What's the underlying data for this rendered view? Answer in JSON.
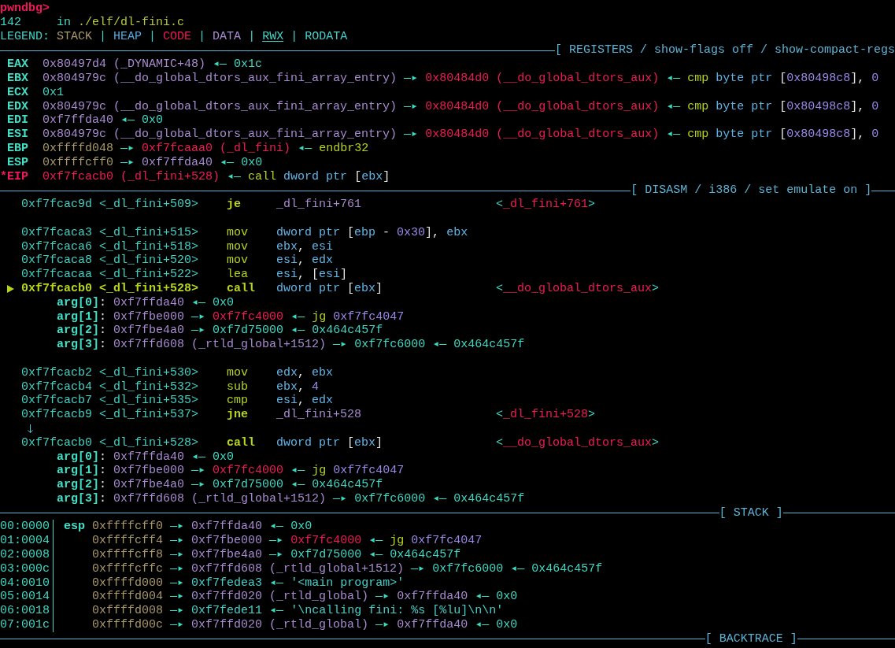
{
  "prompt": "pwndbg>",
  "source": {
    "line_number": "142",
    "location": [
      {
        "text": "in ",
        "kind": "value"
      },
      {
        "text": "./elf/dl-fini.c",
        "kind": "path"
      }
    ]
  },
  "legend": [
    {
      "text": "LEGEND: ",
      "kind": "label"
    },
    {
      "text": "STACK",
      "kind": "stack"
    },
    {
      "text": " | ",
      "kind": "label"
    },
    {
      "text": "HEAP",
      "kind": "heap"
    },
    {
      "text": " | ",
      "kind": "label"
    },
    {
      "text": "CODE",
      "kind": "code"
    },
    {
      "text": " | ",
      "kind": "label"
    },
    {
      "text": "DATA",
      "kind": "data"
    },
    {
      "text": " | ",
      "kind": "label"
    },
    {
      "text": "RWX",
      "kind": "rwx"
    },
    {
      "text": " | ",
      "kind": "label"
    },
    {
      "text": "RODATA",
      "kind": "rodata"
    }
  ],
  "registers": {
    "header": {
      "title": "[ REGISTERS / show-flags off / show-compact-regs",
      "clipped": true
    },
    "rows": [
      {
        "name": "EAX",
        "modified": false,
        "value": [
          {
            "text": "0x80497d4 (_DYNAMIC+48)",
            "kind": "data"
          },
          {
            "text": " ◂— ",
            "kind": "arrow"
          },
          {
            "text": "0x1c",
            "kind": "value"
          }
        ]
      },
      {
        "name": "EBX",
        "modified": false,
        "value": [
          {
            "text": "0x804979c (__do_global_dtors_aux_fini_array_entry)",
            "kind": "data"
          },
          {
            "text": " —▸ ",
            "kind": "arrow"
          },
          {
            "text": "0x80484d0 (__do_global_dtors_aux)",
            "kind": "code"
          },
          {
            "text": " ◂— ",
            "kind": "arrow"
          },
          {
            "text": "cmp ",
            "kind": "insn"
          },
          {
            "text": "byte ptr ",
            "kind": "keyword"
          },
          {
            "text": "[",
            "kind": "punct"
          },
          {
            "text": "0x80498c8",
            "kind": "number"
          },
          {
            "text": "], ",
            "kind": "punct"
          },
          {
            "text": "0",
            "kind": "number"
          }
        ]
      },
      {
        "name": "ECX",
        "modified": false,
        "value": [
          {
            "text": "0x1",
            "kind": "value"
          }
        ]
      },
      {
        "name": "EDX",
        "modified": false,
        "value": [
          {
            "text": "0x804979c (__do_global_dtors_aux_fini_array_entry)",
            "kind": "data"
          },
          {
            "text": " —▸ ",
            "kind": "arrow"
          },
          {
            "text": "0x80484d0 (__do_global_dtors_aux)",
            "kind": "code"
          },
          {
            "text": " ◂— ",
            "kind": "arrow"
          },
          {
            "text": "cmp ",
            "kind": "insn"
          },
          {
            "text": "byte ptr ",
            "kind": "keyword"
          },
          {
            "text": "[",
            "kind": "punct"
          },
          {
            "text": "0x80498c8",
            "kind": "number"
          },
          {
            "text": "], ",
            "kind": "punct"
          },
          {
            "text": "0",
            "kind": "number"
          }
        ]
      },
      {
        "name": "EDI",
        "modified": false,
        "value": [
          {
            "text": "0xf7ffda40",
            "kind": "data"
          },
          {
            "text": " ◂— ",
            "kind": "arrow"
          },
          {
            "text": "0x0",
            "kind": "value"
          }
        ]
      },
      {
        "name": "ESI",
        "modified": false,
        "value": [
          {
            "text": "0x804979c (__do_global_dtors_aux_fini_array_entry)",
            "kind": "data"
          },
          {
            "text": " —▸ ",
            "kind": "arrow"
          },
          {
            "text": "0x80484d0 (__do_global_dtors_aux)",
            "kind": "code"
          },
          {
            "text": " ◂— ",
            "kind": "arrow"
          },
          {
            "text": "cmp ",
            "kind": "insn"
          },
          {
            "text": "byte ptr ",
            "kind": "keyword"
          },
          {
            "text": "[",
            "kind": "punct"
          },
          {
            "text": "0x80498c8",
            "kind": "number"
          },
          {
            "text": "], ",
            "kind": "punct"
          },
          {
            "text": "0",
            "kind": "number"
          }
        ]
      },
      {
        "name": "EBP",
        "modified": false,
        "value": [
          {
            "text": "0xffffd048",
            "kind": "stack"
          },
          {
            "text": " —▸ ",
            "kind": "arrow"
          },
          {
            "text": "0xf7fcaaa0 (_dl_fini)",
            "kind": "code"
          },
          {
            "text": " ◂— ",
            "kind": "arrow"
          },
          {
            "text": "endbr32",
            "kind": "insn"
          }
        ]
      },
      {
        "name": "ESP",
        "modified": false,
        "value": [
          {
            "text": "0xffffcff0",
            "kind": "stack"
          },
          {
            "text": " —▸ ",
            "kind": "arrow"
          },
          {
            "text": "0xf7ffda40",
            "kind": "data"
          },
          {
            "text": " ◂— ",
            "kind": "arrow"
          },
          {
            "text": "0x0",
            "kind": "value"
          }
        ]
      },
      {
        "name": "*EIP",
        "modified": true,
        "value": [
          {
            "text": "0xf7fcacb0 (_dl_fini+528)",
            "kind": "code"
          },
          {
            "text": " ◂— ",
            "kind": "arrow"
          },
          {
            "text": "call ",
            "kind": "insn"
          },
          {
            "text": "dword ptr ",
            "kind": "keyword"
          },
          {
            "text": "[",
            "kind": "punct"
          },
          {
            "text": "ebx",
            "kind": "keyword"
          },
          {
            "text": "]",
            "kind": "punct"
          }
        ]
      }
    ]
  },
  "disasm": {
    "header": {
      "title": "[ DISASM / i386 / set emulate on ]",
      "clipped": false
    },
    "rows": [
      {
        "kind": "instruction",
        "current": false,
        "address": "0xf7fcac9d",
        "symbol": "<_dl_fini+509>",
        "mnemonic": "je",
        "branch": true,
        "operands": [
          {
            "text": "_dl_fini+761",
            "kind": "data"
          }
        ],
        "target": [
          {
            "text": "<",
            "kind": "value"
          },
          {
            "text": "_dl_fini+761",
            "kind": "code"
          },
          {
            "text": ">",
            "kind": "value"
          }
        ]
      },
      {
        "kind": "gap"
      },
      {
        "kind": "instruction",
        "current": false,
        "address": "0xf7fcaca3",
        "symbol": "<_dl_fini+515>",
        "mnemonic": "mov",
        "branch": false,
        "operands": [
          {
            "text": "dword ptr ",
            "kind": "keyword"
          },
          {
            "text": "[",
            "kind": "punct"
          },
          {
            "text": "ebp",
            "kind": "keyword"
          },
          {
            "text": " - ",
            "kind": "punct"
          },
          {
            "text": "0x30",
            "kind": "number"
          },
          {
            "text": "], ",
            "kind": "punct"
          },
          {
            "text": "ebx",
            "kind": "keyword"
          }
        ]
      },
      {
        "kind": "instruction",
        "current": false,
        "address": "0xf7fcaca6",
        "symbol": "<_dl_fini+518>",
        "mnemonic": "mov",
        "branch": false,
        "operands": [
          {
            "text": "ebx",
            "kind": "keyword"
          },
          {
            "text": ", ",
            "kind": "punct"
          },
          {
            "text": "esi",
            "kind": "keyword"
          }
        ]
      },
      {
        "kind": "instruction",
        "current": false,
        "address": "0xf7fcaca8",
        "symbol": "<_dl_fini+520>",
        "mnemonic": "mov",
        "branch": false,
        "operands": [
          {
            "text": "esi",
            "kind": "keyword"
          },
          {
            "text": ", ",
            "kind": "punct"
          },
          {
            "text": "edx",
            "kind": "keyword"
          }
        ]
      },
      {
        "kind": "instruction",
        "current": false,
        "address": "0xf7fcacaa",
        "symbol": "<_dl_fini+522>",
        "mnemonic": "lea",
        "branch": false,
        "operands": [
          {
            "text": "esi",
            "kind": "keyword"
          },
          {
            "text": ", [",
            "kind": "punct"
          },
          {
            "text": "esi",
            "kind": "keyword"
          },
          {
            "text": "]",
            "kind": "punct"
          }
        ]
      },
      {
        "kind": "instruction",
        "current": true,
        "address": "0xf7fcacb0",
        "symbol": "<_dl_fini+528>",
        "mnemonic": "call",
        "branch": true,
        "operands": [
          {
            "text": "dword ptr ",
            "kind": "keyword"
          },
          {
            "text": "[",
            "kind": "punct"
          },
          {
            "text": "ebx",
            "kind": "keyword"
          },
          {
            "text": "]",
            "kind": "punct"
          }
        ],
        "target": [
          {
            "text": "<",
            "kind": "value"
          },
          {
            "text": "__do_global_dtors_aux",
            "kind": "code"
          },
          {
            "text": ">",
            "kind": "value"
          }
        ]
      },
      {
        "kind": "argument",
        "segments": [
          {
            "text": "arg[0]",
            "kind": "argname"
          },
          {
            "text": ": ",
            "kind": "punct"
          },
          {
            "text": "0xf7ffda40",
            "kind": "data"
          },
          {
            "text": " ◂— ",
            "kind": "arrow"
          },
          {
            "text": "0x0",
            "kind": "value"
          }
        ]
      },
      {
        "kind": "argument",
        "segments": [
          {
            "text": "arg[1]",
            "kind": "argname"
          },
          {
            "text": ": ",
            "kind": "punct"
          },
          {
            "text": "0xf7fbe000",
            "kind": "data"
          },
          {
            "text": " —▸ ",
            "kind": "arrow"
          },
          {
            "text": "0xf7fc4000",
            "kind": "code"
          },
          {
            "text": " ◂— ",
            "kind": "arrow"
          },
          {
            "text": "jg ",
            "kind": "insn"
          },
          {
            "text": "0xf7fc4047",
            "kind": "number"
          }
        ]
      },
      {
        "kind": "argument",
        "segments": [
          {
            "text": "arg[2]",
            "kind": "argname"
          },
          {
            "text": ": ",
            "kind": "punct"
          },
          {
            "text": "0xf7fbe4a0",
            "kind": "data"
          },
          {
            "text": " —▸ ",
            "kind": "arrow"
          },
          {
            "text": "0xf7d75000",
            "kind": "value"
          },
          {
            "text": " ◂— ",
            "kind": "arrow"
          },
          {
            "text": "0x464c457f",
            "kind": "value"
          }
        ]
      },
      {
        "kind": "argument",
        "segments": [
          {
            "text": "arg[3]",
            "kind": "argname"
          },
          {
            "text": ": ",
            "kind": "punct"
          },
          {
            "text": "0xf7ffd608 (_rtld_global+1512)",
            "kind": "data"
          },
          {
            "text": " —▸ ",
            "kind": "arrow"
          },
          {
            "text": "0xf7fc6000",
            "kind": "value"
          },
          {
            "text": " ◂— ",
            "kind": "arrow"
          },
          {
            "text": "0x464c457f",
            "kind": "value"
          }
        ]
      },
      {
        "kind": "gap"
      },
      {
        "kind": "instruction",
        "current": false,
        "address": "0xf7fcacb2",
        "symbol": "<_dl_fini+530>",
        "mnemonic": "mov",
        "branch": false,
        "operands": [
          {
            "text": "edx",
            "kind": "keyword"
          },
          {
            "text": ", ",
            "kind": "punct"
          },
          {
            "text": "ebx",
            "kind": "keyword"
          }
        ]
      },
      {
        "kind": "instruction",
        "current": false,
        "address": "0xf7fcacb4",
        "symbol": "<_dl_fini+532>",
        "mnemonic": "sub",
        "branch": false,
        "operands": [
          {
            "text": "ebx",
            "kind": "keyword"
          },
          {
            "text": ", ",
            "kind": "punct"
          },
          {
            "text": "4",
            "kind": "number"
          }
        ]
      },
      {
        "kind": "instruction",
        "current": false,
        "address": "0xf7fcacb7",
        "symbol": "<_dl_fini+535>",
        "mnemonic": "cmp",
        "branch": false,
        "operands": [
          {
            "text": "esi",
            "kind": "keyword"
          },
          {
            "text": ", ",
            "kind": "punct"
          },
          {
            "text": "edx",
            "kind": "keyword"
          }
        ]
      },
      {
        "kind": "instruction",
        "current": false,
        "address": "0xf7fcacb9",
        "symbol": "<_dl_fini+537>",
        "mnemonic": "jne",
        "branch": true,
        "operands": [
          {
            "text": "_dl_fini+528",
            "kind": "data"
          }
        ],
        "target": [
          {
            "text": "<",
            "kind": "value"
          },
          {
            "text": "_dl_fini+528",
            "kind": "code"
          },
          {
            "text": ">",
            "kind": "value"
          }
        ]
      },
      {
        "kind": "jump"
      },
      {
        "kind": "instruction",
        "current": false,
        "address": "0xf7fcacb0",
        "symbol": "<_dl_fini+528>",
        "mnemonic": "call",
        "branch": true,
        "operands": [
          {
            "text": "dword ptr ",
            "kind": "keyword"
          },
          {
            "text": "[",
            "kind": "punct"
          },
          {
            "text": "ebx",
            "kind": "keyword"
          },
          {
            "text": "]",
            "kind": "punct"
          }
        ],
        "target": [
          {
            "text": "<",
            "kind": "value"
          },
          {
            "text": "__do_global_dtors_aux",
            "kind": "code"
          },
          {
            "text": ">",
            "kind": "value"
          }
        ]
      },
      {
        "kind": "argument",
        "segments": [
          {
            "text": "arg[0]",
            "kind": "argname"
          },
          {
            "text": ": ",
            "kind": "punct"
          },
          {
            "text": "0xf7ffda40",
            "kind": "data"
          },
          {
            "text": " ◂— ",
            "kind": "arrow"
          },
          {
            "text": "0x0",
            "kind": "value"
          }
        ]
      },
      {
        "kind": "argument",
        "segments": [
          {
            "text": "arg[1]",
            "kind": "argname"
          },
          {
            "text": ": ",
            "kind": "punct"
          },
          {
            "text": "0xf7fbe000",
            "kind": "data"
          },
          {
            "text": " —▸ ",
            "kind": "arrow"
          },
          {
            "text": "0xf7fc4000",
            "kind": "code"
          },
          {
            "text": " ◂— ",
            "kind": "arrow"
          },
          {
            "text": "jg ",
            "kind": "insn"
          },
          {
            "text": "0xf7fc4047",
            "kind": "number"
          }
        ]
      },
      {
        "kind": "argument",
        "segments": [
          {
            "text": "arg[2]",
            "kind": "argname"
          },
          {
            "text": ": ",
            "kind": "punct"
          },
          {
            "text": "0xf7fbe4a0",
            "kind": "data"
          },
          {
            "text": " —▸ ",
            "kind": "arrow"
          },
          {
            "text": "0xf7d75000",
            "kind": "value"
          },
          {
            "text": " ◂— ",
            "kind": "arrow"
          },
          {
            "text": "0x464c457f",
            "kind": "value"
          }
        ]
      },
      {
        "kind": "argument",
        "segments": [
          {
            "text": "arg[3]",
            "kind": "argname"
          },
          {
            "text": ": ",
            "kind": "punct"
          },
          {
            "text": "0xf7ffd608 (_rtld_global+1512)",
            "kind": "data"
          },
          {
            "text": " —▸ ",
            "kind": "arrow"
          },
          {
            "text": "0xf7fc6000",
            "kind": "value"
          },
          {
            "text": " ◂— ",
            "kind": "arrow"
          },
          {
            "text": "0x464c457f",
            "kind": "value"
          }
        ]
      }
    ]
  },
  "stack": {
    "header": {
      "title": "[ STACK ]",
      "clipped": false
    },
    "rows": [
      {
        "offset": "00:0000",
        "register": "esp",
        "value": [
          {
            "text": "0xffffcff0",
            "kind": "stack"
          },
          {
            "text": " —▸ ",
            "kind": "arrow"
          },
          {
            "text": "0xf7ffda40",
            "kind": "data"
          },
          {
            "text": " ◂— ",
            "kind": "arrow"
          },
          {
            "text": "0x0",
            "kind": "value"
          }
        ]
      },
      {
        "offset": "01:0004",
        "value": [
          {
            "text": "0xffffcff4",
            "kind": "stack"
          },
          {
            "text": " —▸ ",
            "kind": "arrow"
          },
          {
            "text": "0xf7fbe000",
            "kind": "data"
          },
          {
            "text": " —▸ ",
            "kind": "arrow"
          },
          {
            "text": "0xf7fc4000",
            "kind": "code"
          },
          {
            "text": " ◂— ",
            "kind": "arrow"
          },
          {
            "text": "jg ",
            "kind": "insn"
          },
          {
            "text": "0xf7fc4047",
            "kind": "number"
          }
        ]
      },
      {
        "offset": "02:0008",
        "value": [
          {
            "text": "0xffffcff8",
            "kind": "stack"
          },
          {
            "text": " —▸ ",
            "kind": "arrow"
          },
          {
            "text": "0xf7fbe4a0",
            "kind": "data"
          },
          {
            "text": " —▸ ",
            "kind": "arrow"
          },
          {
            "text": "0xf7d75000",
            "kind": "value"
          },
          {
            "text": " ◂— ",
            "kind": "arrow"
          },
          {
            "text": "0x464c457f",
            "kind": "value"
          }
        ]
      },
      {
        "offset": "03:000c",
        "value": [
          {
            "text": "0xffffcffc",
            "kind": "stack"
          },
          {
            "text": " —▸ ",
            "kind": "arrow"
          },
          {
            "text": "0xf7ffd608 (_rtld_global+1512)",
            "kind": "data"
          },
          {
            "text": " —▸ ",
            "kind": "arrow"
          },
          {
            "text": "0xf7fc6000",
            "kind": "value"
          },
          {
            "text": " ◂— ",
            "kind": "arrow"
          },
          {
            "text": "0x464c457f",
            "kind": "value"
          }
        ]
      },
      {
        "offset": "04:0010",
        "value": [
          {
            "text": "0xffffd000",
            "kind": "stack"
          },
          {
            "text": " —▸ ",
            "kind": "arrow"
          },
          {
            "text": "0xf7fedea3",
            "kind": "rodata"
          },
          {
            "text": " ◂— ",
            "kind": "arrow"
          },
          {
            "text": "'<main program>'",
            "kind": "rodata"
          }
        ]
      },
      {
        "offset": "05:0014",
        "value": [
          {
            "text": "0xffffd004",
            "kind": "stack"
          },
          {
            "text": " —▸ ",
            "kind": "arrow"
          },
          {
            "text": "0xf7ffd020 (_rtld_global)",
            "kind": "data"
          },
          {
            "text": " —▸ ",
            "kind": "arrow"
          },
          {
            "text": "0xf7ffda40",
            "kind": "data"
          },
          {
            "text": " ◂— ",
            "kind": "arrow"
          },
          {
            "text": "0x0",
            "kind": "value"
          }
        ]
      },
      {
        "offset": "06:0018",
        "value": [
          {
            "text": "0xffffd008",
            "kind": "stack"
          },
          {
            "text": " —▸ ",
            "kind": "arrow"
          },
          {
            "text": "0xf7fede11",
            "kind": "rodata"
          },
          {
            "text": " ◂— ",
            "kind": "arrow"
          },
          {
            "text": "'\\ncalling fini: %s [%lu]\\n\\n'",
            "kind": "rodata"
          }
        ]
      },
      {
        "offset": "07:001c",
        "value": [
          {
            "text": "0xffffd00c",
            "kind": "stack"
          },
          {
            "text": " —▸ ",
            "kind": "arrow"
          },
          {
            "text": "0xf7ffd020 (_rtld_global)",
            "kind": "data"
          },
          {
            "text": " —▸ ",
            "kind": "arrow"
          },
          {
            "text": "0xf7ffda40",
            "kind": "data"
          },
          {
            "text": " ◂— ",
            "kind": "arrow"
          },
          {
            "text": "0x0",
            "kind": "value"
          }
        ]
      }
    ]
  },
  "backtrace": {
    "header": {
      "title": "[ BACKTRACE ]",
      "clipped": false
    }
  }
}
